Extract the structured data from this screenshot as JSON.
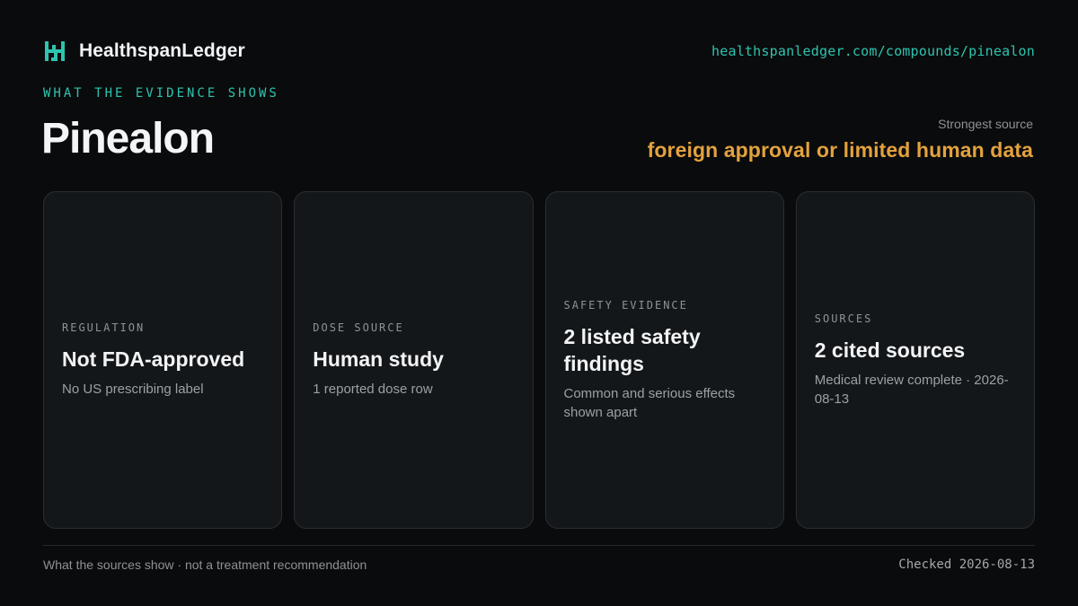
{
  "brand": {
    "name": "HealthspanLedger",
    "logo_icon": "ledger-h-icon",
    "accent_color": "#2ec4b0"
  },
  "url": "healthspanledger.com/compounds/pinealon",
  "eyebrow": "WHAT THE EVIDENCE SHOWS",
  "title": "Pinealon",
  "strongest_source": {
    "label": "Strongest source",
    "value": "foreign approval or limited human data",
    "color": "#e3a23d"
  },
  "cards": [
    {
      "label": "REGULATION",
      "value": "Not FDA-approved",
      "note": "No US prescribing label"
    },
    {
      "label": "DOSE SOURCE",
      "value": "Human study",
      "note": "1 reported dose row"
    },
    {
      "label": "SAFETY EVIDENCE",
      "value": "2 listed safety findings",
      "note": "Common and serious effects shown apart"
    },
    {
      "label": "SOURCES",
      "value": "2 cited sources",
      "note": "Medical review complete · 2026-08-13"
    }
  ],
  "footer": {
    "disclaimer": "What the sources show · not a treatment recommendation",
    "checked": "Checked 2026-08-13"
  }
}
